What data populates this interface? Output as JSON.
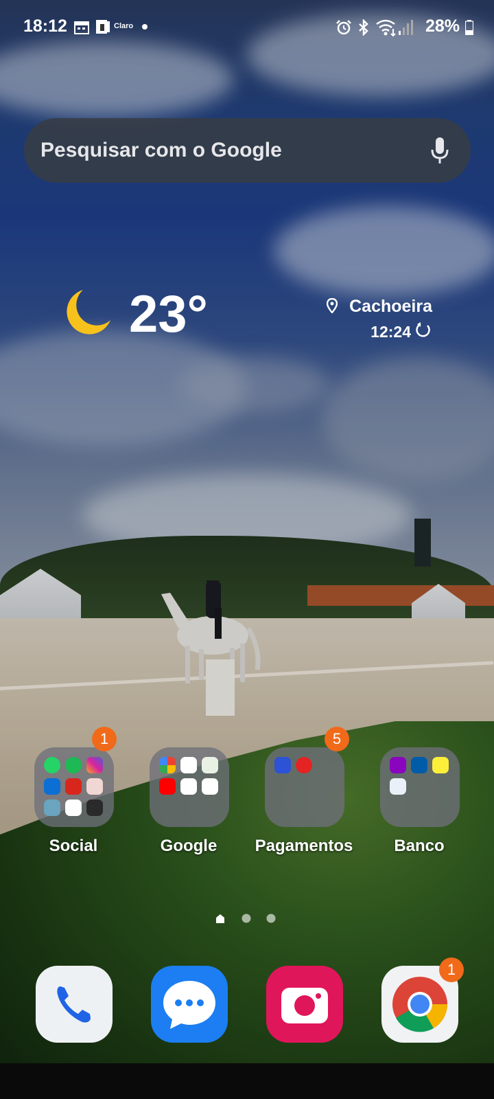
{
  "status_bar": {
    "time": "18:12",
    "carrier": "Claro",
    "battery": "28%",
    "icons": [
      "calendar-icon",
      "sim-icon",
      "claro-icon",
      "dot-icon",
      "alarm-icon",
      "bluetooth-icon",
      "wifi-icon",
      "signal-icon",
      "battery-icon"
    ]
  },
  "search": {
    "placeholder": "Pesquisar com o Google",
    "icon": "mic-icon"
  },
  "weather": {
    "icon": "moon-icon",
    "temperature": "23°",
    "location": "Cachoeira",
    "updated_time": "12:24"
  },
  "folders": [
    {
      "label": "Social",
      "badge": "1"
    },
    {
      "label": "Google",
      "badge": ""
    },
    {
      "label": "Pagamentos",
      "badge": "5"
    },
    {
      "label": "Banco",
      "badge": ""
    }
  ],
  "pages": {
    "count": 3,
    "current": 1
  },
  "dock": [
    {
      "name": "phone-icon",
      "badge": ""
    },
    {
      "name": "messages-icon",
      "badge": ""
    },
    {
      "name": "camera-icon",
      "badge": ""
    },
    {
      "name": "chrome-icon",
      "badge": "1"
    }
  ],
  "colors": {
    "badge": "#f06a1a",
    "accent_moon": "#f8c21c"
  }
}
